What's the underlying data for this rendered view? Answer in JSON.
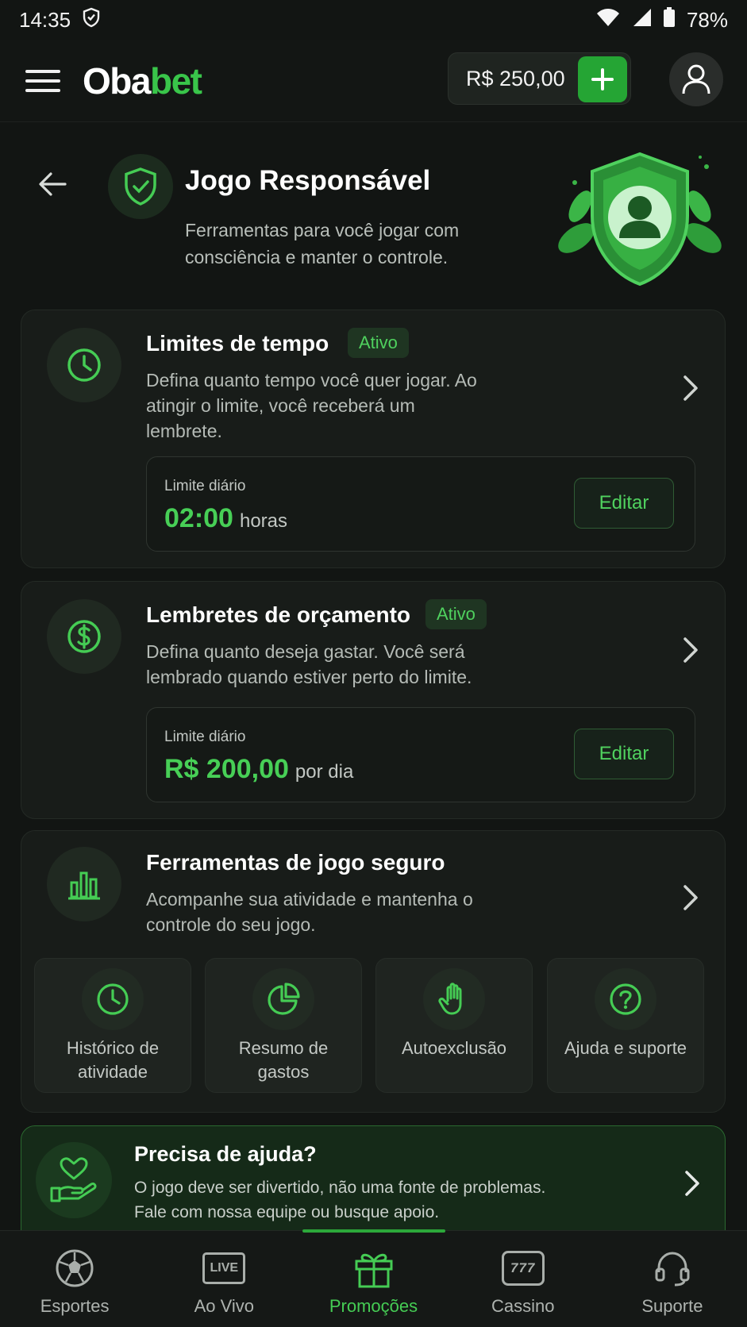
{
  "status_bar": {
    "time": "14:35",
    "battery": "78%"
  },
  "header": {
    "logo_part1": "Oba",
    "logo_part2": "bet",
    "balance": "R$ 250,00"
  },
  "page": {
    "title": "Jogo Responsável",
    "subtitle": "Ferramentas para você jogar com consciência e manter o controle."
  },
  "cards": [
    {
      "title": "Limites de tempo",
      "badge": "Ativo",
      "description": "Defina quanto tempo você quer jogar. Ao atingir o limite, você receberá um lembrete.",
      "limit_label": "Limite diário",
      "limit_value": "02:00",
      "limit_unit": "horas",
      "edit_label": "Editar",
      "icon": "clock-icon"
    },
    {
      "title": "Lembretes de orçamento",
      "badge": "Ativo",
      "description": "Defina quanto deseja gastar. Você será lembrado quando estiver perto do limite.",
      "limit_label": "Limite diário",
      "limit_value": "R$ 200,00",
      "limit_unit": "por dia",
      "edit_label": "Editar",
      "icon": "dollar-icon"
    },
    {
      "title": "Ferramentas de jogo seguro",
      "description": "Acompanhe sua atividade e mantenha o controle do seu jogo.",
      "icon": "bar-chart-icon",
      "tools": [
        {
          "label": "Histórico de atividade",
          "icon": "clock-icon"
        },
        {
          "label": "Resumo de gastos",
          "icon": "pie-chart-icon"
        },
        {
          "label": "Autoexclusão",
          "icon": "hand-icon"
        },
        {
          "label": "Ajuda e suporte",
          "icon": "question-icon"
        }
      ]
    }
  ],
  "help": {
    "title": "Precisa de ajuda?",
    "description": "O jogo deve ser divertido, não uma fonte de problemas. Fale com nossa equipe ou busque apoio."
  },
  "bottom_nav": [
    {
      "label": "Esportes",
      "icon": "soccer-ball-icon"
    },
    {
      "label": "Ao Vivo",
      "icon": "live-icon",
      "icon_text": "LIVE"
    },
    {
      "label": "Promoções",
      "icon": "gift-icon",
      "active": true
    },
    {
      "label": "Cassino",
      "icon": "slot-machine-icon",
      "icon_text": "777"
    },
    {
      "label": "Suporte",
      "icon": "headset-icon"
    }
  ],
  "colors": {
    "accent": "#39c54a",
    "background": "#121513",
    "card": "#181c19"
  }
}
